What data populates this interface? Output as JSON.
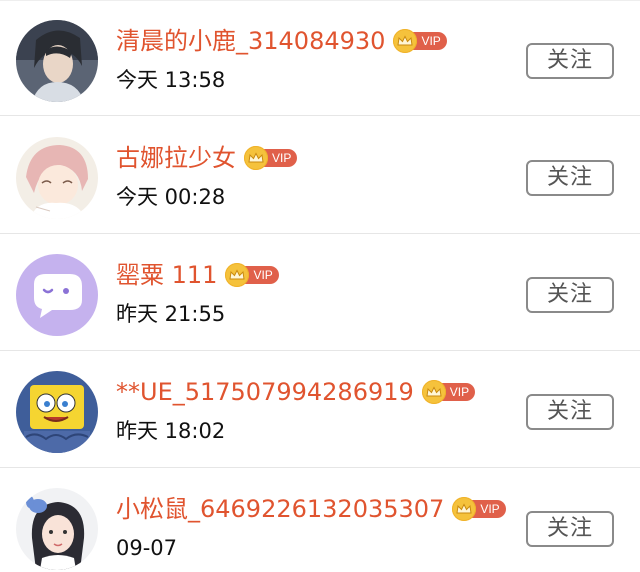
{
  "followers": [
    {
      "name": "清晨的小鹿_314084930",
      "time": "今天 13:58",
      "vip_label": "VIP",
      "avatar_icon": "anime-man-avatar-icon",
      "follow_label": "关注"
    },
    {
      "name": "古娜拉少女",
      "time": "今天 00:28",
      "vip_label": "VIP",
      "avatar_icon": "pink-hair-girl-avatar-icon",
      "follow_label": "关注"
    },
    {
      "name": "罂粟 111",
      "time": "昨天 21:55",
      "vip_label": "VIP",
      "avatar_icon": "purple-chat-bubble-avatar-icon",
      "follow_label": "关注"
    },
    {
      "name": "**UE_517507994286919",
      "time": "昨天 18:02",
      "vip_label": "VIP",
      "avatar_icon": "spongebob-avatar-icon",
      "follow_label": "关注"
    },
    {
      "name": "小松鼠_6469226132035307",
      "time": "09-07",
      "vip_label": "VIP",
      "avatar_icon": "girl-with-stitch-avatar-icon",
      "follow_label": "关注"
    }
  ],
  "colors": {
    "name": "#e0542f",
    "vip_tag": "#e0604a",
    "vip_crown": "#f5c23c",
    "button_border": "#8a8a8a"
  }
}
